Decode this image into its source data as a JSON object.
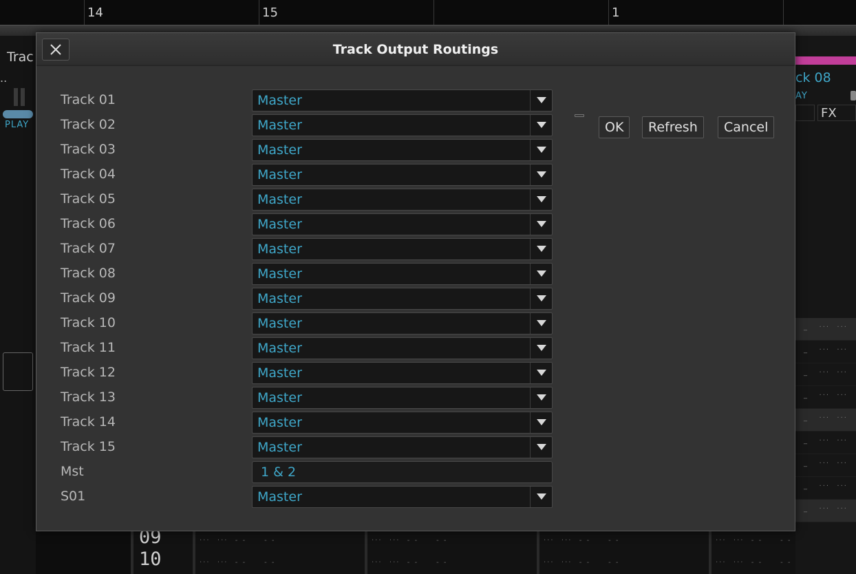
{
  "background": {
    "ruler_labels": [
      "14",
      "15",
      "1"
    ],
    "left_panel": {
      "title": "Trac",
      "dots": "..",
      "play": "PLAY"
    },
    "right_panel": {
      "track": "ck 08",
      "play": "AY",
      "fx": "FX"
    },
    "bottom_numbers": [
      "09",
      "10"
    ]
  },
  "dialog": {
    "title": "Track Output Routings",
    "close_icon": "close-icon",
    "buttons": {
      "ok": "OK",
      "refresh": "Refresh",
      "cancel": "Cancel"
    },
    "rows": [
      {
        "label": "Track 01",
        "value": "Master",
        "type": "select"
      },
      {
        "label": "Track 02",
        "value": "Master",
        "type": "select"
      },
      {
        "label": "Track 03",
        "value": "Master",
        "type": "select"
      },
      {
        "label": "Track 04",
        "value": "Master",
        "type": "select"
      },
      {
        "label": "Track 05",
        "value": "Master",
        "type": "select"
      },
      {
        "label": "Track 06",
        "value": "Master",
        "type": "select"
      },
      {
        "label": "Track 07",
        "value": "Master",
        "type": "select"
      },
      {
        "label": "Track 08",
        "value": "Master",
        "type": "select"
      },
      {
        "label": "Track 09",
        "value": "Master",
        "type": "select"
      },
      {
        "label": "Track 10",
        "value": "Master",
        "type": "select"
      },
      {
        "label": "Track 11",
        "value": "Master",
        "type": "select"
      },
      {
        "label": "Track 12",
        "value": "Master",
        "type": "select"
      },
      {
        "label": "Track 13",
        "value": "Master",
        "type": "select"
      },
      {
        "label": "Track 14",
        "value": "Master",
        "type": "select"
      },
      {
        "label": "Track 15",
        "value": "Master",
        "type": "select"
      },
      {
        "label": "Mst",
        "value": "1 & 2",
        "type": "fixed"
      },
      {
        "label": "S01",
        "value": "Master",
        "type": "select"
      }
    ]
  },
  "colors": {
    "accent": "#3fa7c9",
    "dialog_bg": "#333333",
    "select_bg": "#171717",
    "pink": "#c23e9a"
  }
}
